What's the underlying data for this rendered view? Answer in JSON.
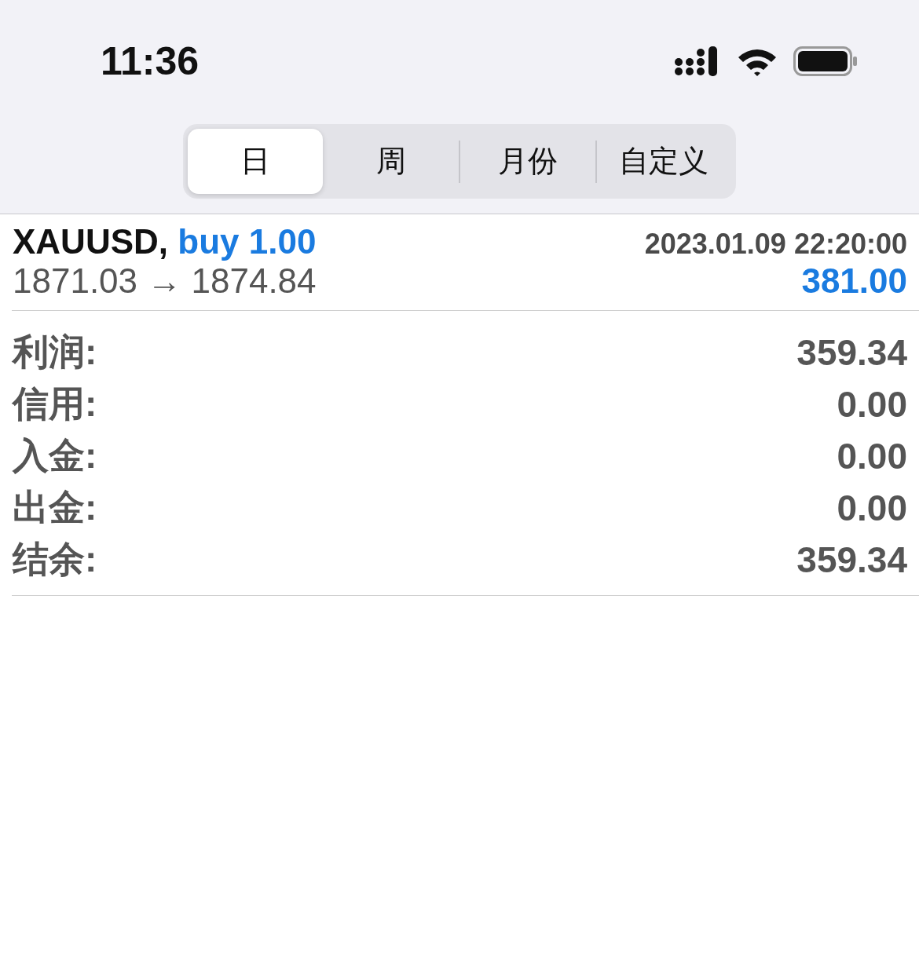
{
  "status_bar": {
    "time": "11:36"
  },
  "segments": [
    {
      "label": "日",
      "selected": true
    },
    {
      "label": "周",
      "selected": false
    },
    {
      "label": "月份",
      "selected": false
    },
    {
      "label": "自定义",
      "selected": false
    }
  ],
  "trade": {
    "symbol": "XAUUSD,",
    "side": "buy 1.00",
    "time": "2023.01.09 22:20:00",
    "prices": "1871.03 → 1874.84",
    "amount": "381.00"
  },
  "summary": [
    {
      "label": "利润:",
      "value": "359.34"
    },
    {
      "label": "信用:",
      "value": "0.00"
    },
    {
      "label": "入金:",
      "value": "0.00"
    },
    {
      "label": "出金:",
      "value": "0.00"
    },
    {
      "label": "结余:",
      "value": "359.34"
    }
  ]
}
